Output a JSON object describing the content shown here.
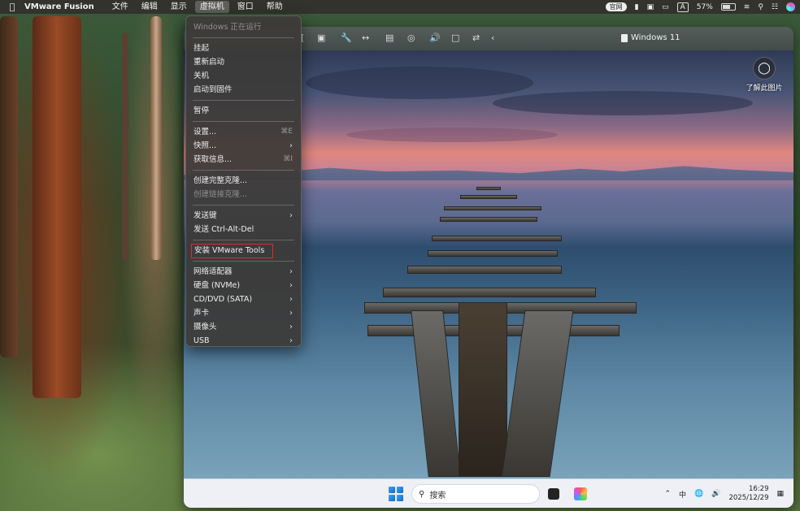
{
  "menubar": {
    "app_name": "VMware Fusion",
    "menus": [
      "文件",
      "编辑",
      "显示",
      "虚拟机",
      "窗口",
      "帮助"
    ],
    "active_menu": "虚拟机",
    "status": {
      "input_badge": "官网",
      "input_letter": "A",
      "battery_percent": "57%"
    }
  },
  "vm_window": {
    "title": "Windows 11",
    "learn_picture_label": "了解此图片"
  },
  "vm_menu": {
    "status_label": "Windows 正在运行",
    "items_group1": [
      "挂起",
      "重新启动",
      "关机",
      "启动到固件"
    ],
    "pause": "暂停",
    "settings": {
      "label": "设置...",
      "shortcut": "⌘E"
    },
    "snapshots": "快照...",
    "get_info": {
      "label": "获取信息...",
      "shortcut": "⌘I"
    },
    "create_full_clone": "创建完整克隆...",
    "create_linked_clone": "创建链接克隆...",
    "send_key": "发送键",
    "send_ctrl_alt_del": "发送 Ctrl-Alt-Del",
    "install_tools": "安装 VMware Tools",
    "devices": [
      "网络适配器",
      "硬盘 (NVMe)",
      "CD/DVD (SATA)",
      "声卡",
      "摄像头",
      "USB"
    ]
  },
  "taskbar": {
    "search_placeholder": "搜索",
    "tray_ime": "中",
    "time": "16:29",
    "date": "2025/12/29"
  }
}
